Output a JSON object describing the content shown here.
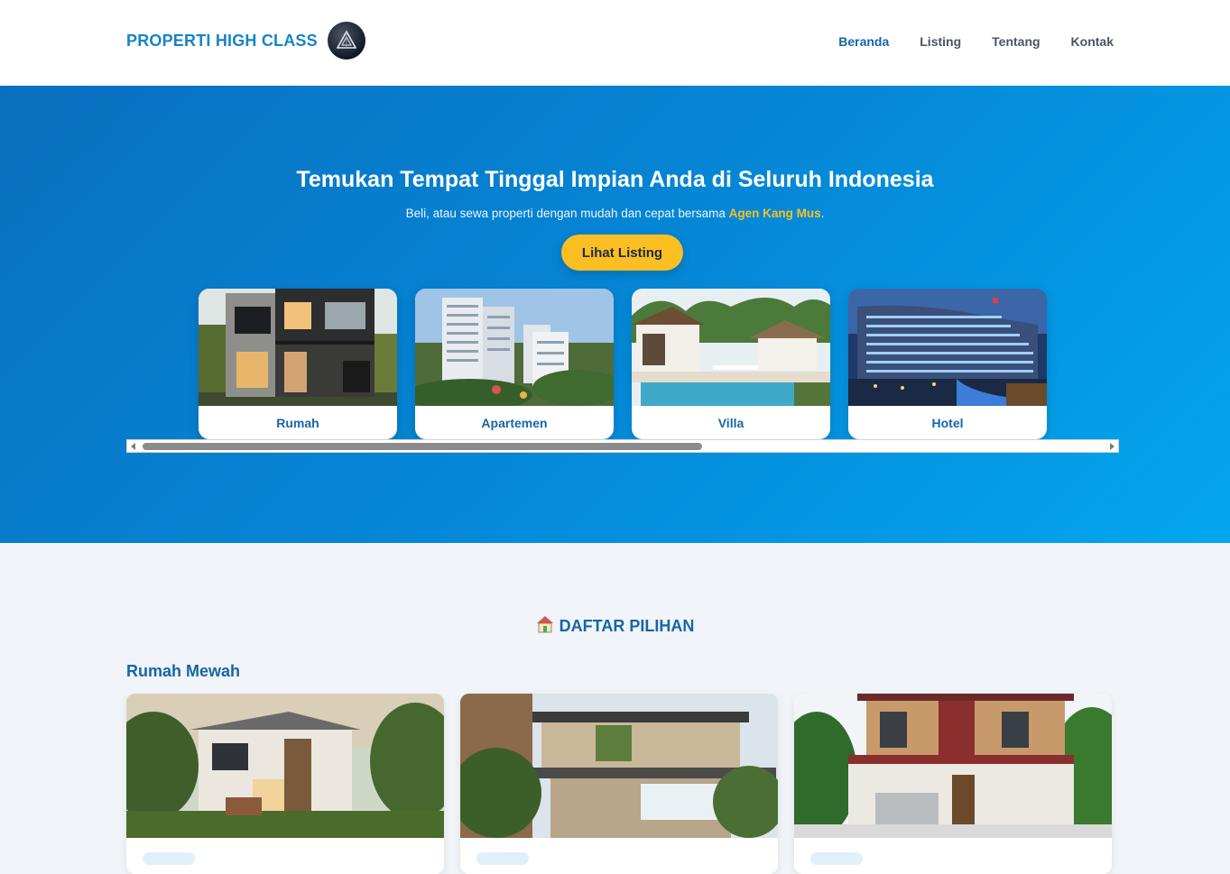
{
  "header": {
    "brand": "PROPERTI HIGH CLASS",
    "logo_icon": "brand-logo-icon",
    "nav": [
      {
        "label": "Beranda",
        "active": true
      },
      {
        "label": "Listing",
        "active": false
      },
      {
        "label": "Tentang",
        "active": false
      },
      {
        "label": "Kontak",
        "active": false
      }
    ]
  },
  "hero": {
    "title": "Temukan Tempat Tinggal Impian Anda di Seluruh Indonesia",
    "subtitle_before": "Beli, atau sewa properti dengan mudah dan cepat bersama ",
    "subtitle_agent": "Agen Kang Mus",
    "subtitle_after": ".",
    "cta_label": "Lihat Listing",
    "categories": [
      {
        "label": "Rumah",
        "image": "modern-house-photo"
      },
      {
        "label": "Apartemen",
        "image": "apartment-towers-photo"
      },
      {
        "label": "Villa",
        "image": "villa-pool-photo"
      },
      {
        "label": "Hotel",
        "image": "hotel-night-photo"
      }
    ]
  },
  "listing_section": {
    "title": "DAFTAR PILIHAN",
    "title_icon": "house-icon",
    "category_title": "Rumah Mewah",
    "items": [
      {
        "image": "two-story-house-photo"
      },
      {
        "image": "luxury-modern-house-photo"
      },
      {
        "image": "red-brick-house-photo"
      }
    ]
  },
  "colors": {
    "brand_blue": "#1784c5",
    "nav_active": "#1566a8",
    "accent_yellow": "#fbbf24",
    "hero_start": "#0a6fbf",
    "hero_end": "#03a6ef"
  }
}
